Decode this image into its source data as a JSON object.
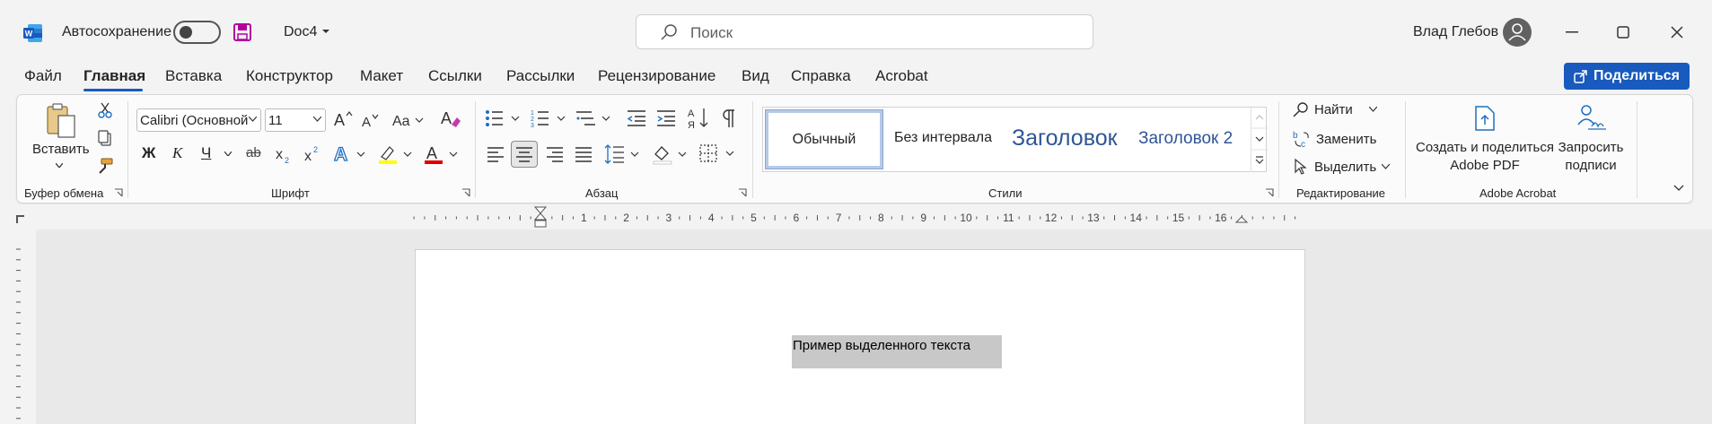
{
  "titlebar": {
    "autosave_label": "Автосохранение",
    "doc_name": "Doc4",
    "search_placeholder": "Поиск",
    "user_name": "Влад Глебов"
  },
  "menu": {
    "tabs": [
      "Файл",
      "Главная",
      "Вставка",
      "Конструктор",
      "Макет",
      "Ссылки",
      "Рассылки",
      "Рецензирование",
      "Вид",
      "Справка",
      "Acrobat"
    ],
    "active": "Главная",
    "share_label": "Поделиться"
  },
  "ribbon": {
    "clipboard": {
      "paste_label": "Вставить",
      "group_label": "Буфер обмена"
    },
    "font": {
      "font_name": "Calibri (Основной текст)",
      "font_size": "11",
      "group_label": "Шрифт",
      "bold": "Ж",
      "italic": "К",
      "underline": "Ч",
      "strike": "ab",
      "case": "Aa"
    },
    "paragraph": {
      "group_label": "Абзац"
    },
    "styles": {
      "items": [
        "Обычный",
        "Без интервала",
        "Заголовок",
        "Заголовок 2"
      ],
      "group_label": "Стили"
    },
    "editing": {
      "find": "Найти",
      "replace": "Заменить",
      "select": "Выделить",
      "group_label": "Редактирование"
    },
    "acrobat": {
      "create_pdf": "Создать и поделиться Adobe PDF",
      "create_pdf_line1": "Создать и поделиться",
      "create_pdf_line2": "Adobe PDF",
      "request_sign_line1": "Запросить",
      "request_sign_line2": "подписи",
      "group_label": "Adobe Acrobat"
    }
  },
  "ruler": {
    "numbers": [
      "1",
      "2",
      "3",
      "4",
      "5",
      "6",
      "7",
      "8",
      "9",
      "10",
      "11",
      "12",
      "13",
      "14",
      "15",
      "16"
    ]
  },
  "document": {
    "selected_text": "Пример выделенного текста"
  },
  "colors": {
    "accent": "#185abd",
    "save_icon": "#b4009e",
    "highlight": "#ffff00",
    "font_color": "#e00000",
    "selection": "#c8c8c8"
  }
}
